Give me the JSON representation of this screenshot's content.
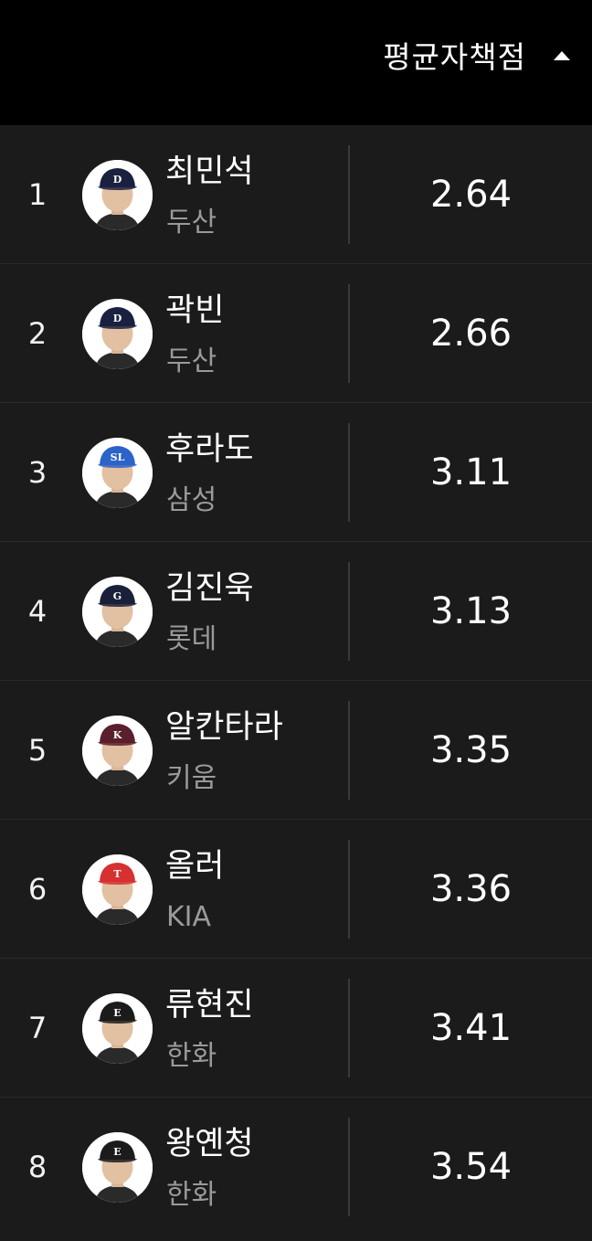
{
  "header": {
    "sort_label": "평균자책점",
    "sort_icon": "caret-up-icon"
  },
  "players": [
    {
      "rank": "1",
      "name": "최민석",
      "team": "두산",
      "era": "2.64",
      "cap_color": "#1a2040",
      "logo": "D"
    },
    {
      "rank": "2",
      "name": "곽빈",
      "team": "두산",
      "era": "2.66",
      "cap_color": "#1a2040",
      "logo": "D"
    },
    {
      "rank": "3",
      "name": "후라도",
      "team": "삼성",
      "era": "3.11",
      "cap_color": "#2c63c9",
      "logo": "SL"
    },
    {
      "rank": "4",
      "name": "김진욱",
      "team": "롯데",
      "era": "3.13",
      "cap_color": "#1a1f3a",
      "logo": "G"
    },
    {
      "rank": "5",
      "name": "알칸타라",
      "team": "키움",
      "era": "3.35",
      "cap_color": "#5a1f2c",
      "logo": "K"
    },
    {
      "rank": "6",
      "name": "올러",
      "team": "KIA",
      "era": "3.36",
      "cap_color": "#d63030",
      "logo": "T"
    },
    {
      "rank": "7",
      "name": "류현진",
      "team": "한화",
      "era": "3.41",
      "cap_color": "#1b1b1b",
      "logo": "E"
    },
    {
      "rank": "8",
      "name": "왕옌청",
      "team": "한화",
      "era": "3.54",
      "cap_color": "#1b1b1b",
      "logo": "E"
    }
  ]
}
